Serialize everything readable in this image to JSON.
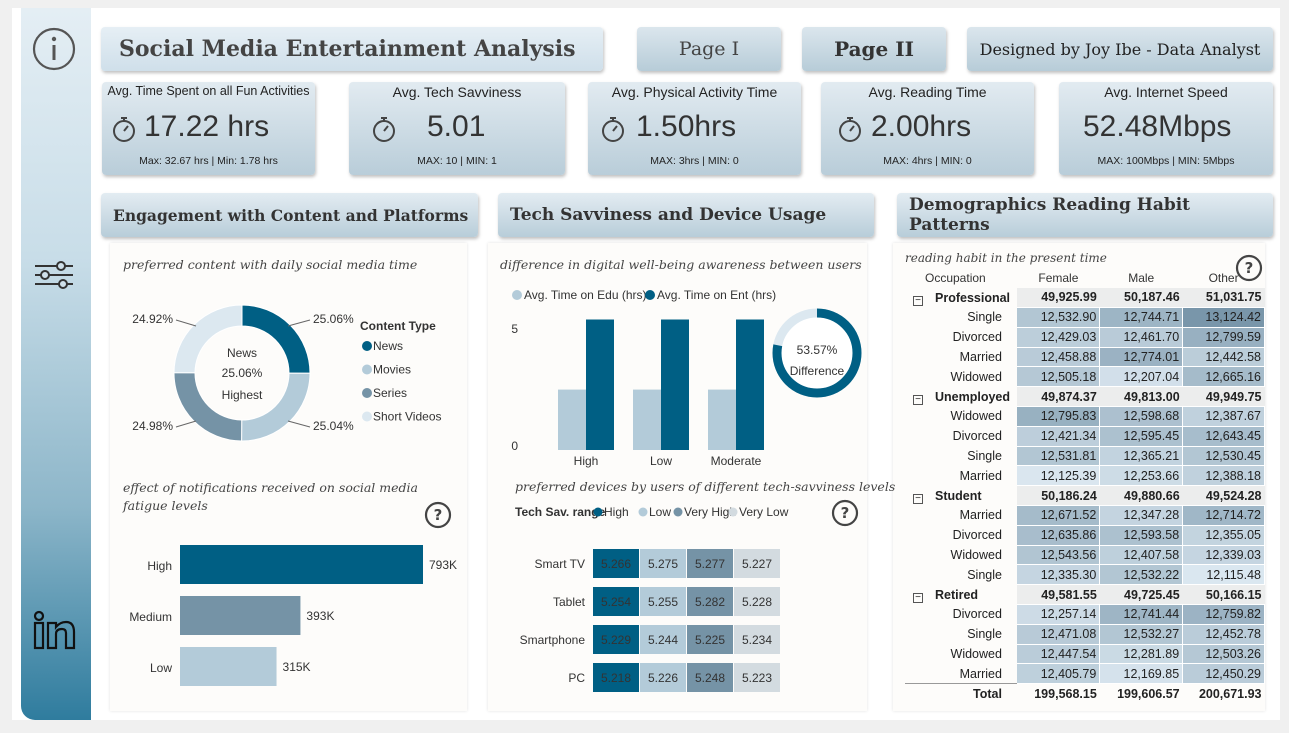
{
  "header": {
    "title": "Social Media Entertainment Analysis",
    "page1": "Page I",
    "page2": "Page II",
    "credit": "Designed by Joy Ibe - Data Analyst"
  },
  "kpis": [
    {
      "title": "Avg. Time Spent on all Fun Activities",
      "value": "17.22 hrs",
      "sub": "Max: 32.67 hrs | Min: 1.78 hrs"
    },
    {
      "title": "Avg. Tech Savviness",
      "value": "5.01",
      "sub": "MAX: 10 | MIN: 1"
    },
    {
      "title": "Avg. Physical Activity Time",
      "value": "1.50hrs",
      "sub": "MAX: 3hrs  | MIN: 0"
    },
    {
      "title": "Avg. Reading Time",
      "value": "2.00hrs",
      "sub": "MAX: 4hrs  | MIN: 0"
    },
    {
      "title": "Avg. Internet Speed",
      "value": "52.48Mbps",
      "sub": "MAX: 100Mbps  | MIN: 5Mbps"
    }
  ],
  "sections": {
    "s1": "Engagement with Content and Platforms",
    "s2": "Tech Savviness and Device Usage",
    "s3": "Demographics Reading Habit Patterns"
  },
  "donut": {
    "title": "preferred content with daily social media time",
    "center_label": "News",
    "center_value": "25.06%",
    "center_sub": "Highest",
    "legend_title": "Content Type",
    "colors": [
      "#005f84",
      "#b3cbd9",
      "#7593a6",
      "#dce8f0"
    ],
    "chart_data": {
      "type": "pie",
      "categories": [
        "News",
        "Movies",
        "Series",
        "Short Videos"
      ],
      "values": [
        25.06,
        25.04,
        24.98,
        24.92
      ],
      "labels": [
        "25.06%",
        "25.04%",
        "24.98%",
        "24.92%"
      ]
    }
  },
  "notif": {
    "title": "effect of notifications received on social media fatigue levels",
    "chart_data": {
      "type": "bar",
      "categories": [
        "High",
        "Medium",
        "Low"
      ],
      "values": [
        793,
        393,
        315
      ],
      "labels": [
        "793K",
        "393K",
        "315K"
      ],
      "colors": [
        "#005f84",
        "#7593a6",
        "#b3cbd9"
      ]
    }
  },
  "wellbeing": {
    "title": "difference in digital well-being awareness between users",
    "ring_value": "53.57%",
    "ring_label": "Difference",
    "chart_data": {
      "type": "bar",
      "categories": [
        "High",
        "Low",
        "Moderate"
      ],
      "series": [
        {
          "name": "Avg. Time on Edu (hrs)",
          "values": [
            2.5,
            2.5,
            2.5
          ],
          "color": "#b3cbd9"
        },
        {
          "name": "Avg. Time on Ent (hrs)",
          "values": [
            5.4,
            5.4,
            5.4
          ],
          "color": "#005f84"
        }
      ],
      "yticks": [
        "5",
        "0"
      ],
      "ylim": [
        0,
        6
      ]
    }
  },
  "devices": {
    "title": "preferred devices by users of different tech-savviness levels",
    "legend_title": "Tech Sav. range",
    "chart_data": {
      "type": "heatmap",
      "rows": [
        "Smart TV",
        "Tablet",
        "Smartphone",
        "PC"
      ],
      "columns": [
        "High",
        "Low",
        "Very High",
        "Very Low"
      ],
      "colors": [
        "#005f84",
        "#b3cbd9",
        "#7593a6",
        "#d3dbe0"
      ],
      "values": [
        [
          "5.266",
          "5.275",
          "5.277",
          "5.227"
        ],
        [
          "5.254",
          "5.255",
          "5.282",
          "5.228"
        ],
        [
          "5.229",
          "5.244",
          "5.225",
          "5.234"
        ],
        [
          "5.218",
          "5.226",
          "5.248",
          "5.223"
        ]
      ]
    }
  },
  "matrix": {
    "title": "reading habit in the present time",
    "headers": [
      "Occupation",
      "Female",
      "Male",
      "Other"
    ],
    "total_label": "Total",
    "totals": [
      "199,568.15",
      "199,606.57",
      "200,671.93"
    ],
    "groups": [
      {
        "name": "Professional",
        "vals": [
          "49,925.99",
          "50,187.46",
          "51,031.75"
        ],
        "rows": [
          {
            "name": "Single",
            "vals": [
              "12,532.90",
              "12,744.71",
              "13,124.42"
            ]
          },
          {
            "name": "Divorced",
            "vals": [
              "12,429.03",
              "12,461.70",
              "12,799.59"
            ]
          },
          {
            "name": "Married",
            "vals": [
              "12,458.88",
              "12,774.01",
              "12,442.58"
            ]
          },
          {
            "name": "Widowed",
            "vals": [
              "12,505.18",
              "12,207.04",
              "12,665.16"
            ]
          }
        ]
      },
      {
        "name": "Unemployed",
        "vals": [
          "49,874.37",
          "49,813.00",
          "49,949.75"
        ],
        "rows": [
          {
            "name": "Widowed",
            "vals": [
              "12,795.83",
              "12,598.68",
              "12,387.67"
            ]
          },
          {
            "name": "Divorced",
            "vals": [
              "12,421.34",
              "12,595.45",
              "12,643.45"
            ]
          },
          {
            "name": "Single",
            "vals": [
              "12,531.81",
              "12,365.21",
              "12,530.45"
            ]
          },
          {
            "name": "Married",
            "vals": [
              "12,125.39",
              "12,253.66",
              "12,388.18"
            ]
          }
        ]
      },
      {
        "name": "Student",
        "vals": [
          "50,186.24",
          "49,880.66",
          "49,524.28"
        ],
        "rows": [
          {
            "name": "Married",
            "vals": [
              "12,671.52",
              "12,347.28",
              "12,714.72"
            ]
          },
          {
            "name": "Divorced",
            "vals": [
              "12,635.86",
              "12,593.58",
              "12,355.05"
            ]
          },
          {
            "name": "Widowed",
            "vals": [
              "12,543.56",
              "12,407.58",
              "12,339.03"
            ]
          },
          {
            "name": "Single",
            "vals": [
              "12,335.30",
              "12,532.22",
              "12,115.48"
            ]
          }
        ]
      },
      {
        "name": "Retired",
        "vals": [
          "49,581.55",
          "49,725.45",
          "50,166.15"
        ],
        "rows": [
          {
            "name": "Divorced",
            "vals": [
              "12,257.14",
              "12,741.44",
              "12,759.82"
            ]
          },
          {
            "name": "Single",
            "vals": [
              "12,471.08",
              "12,532.27",
              "12,452.78"
            ]
          },
          {
            "name": "Widowed",
            "vals": [
              "12,447.54",
              "12,281.89",
              "12,503.26"
            ]
          },
          {
            "name": "Married",
            "vals": [
              "12,405.79",
              "12,169.85",
              "12,450.29"
            ]
          }
        ]
      }
    ]
  }
}
